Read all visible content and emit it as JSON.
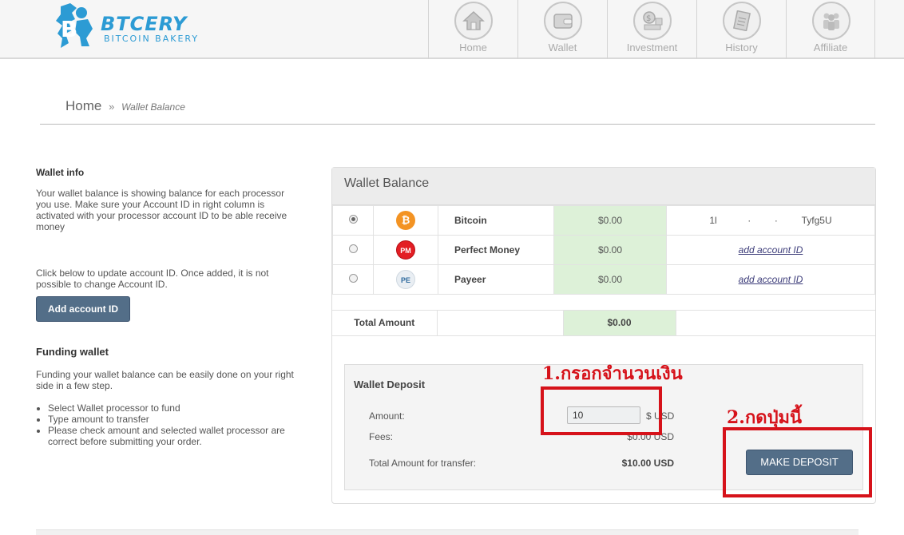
{
  "brand": {
    "title": "BTCERY",
    "subtitle": "BITCOIN BAKERY"
  },
  "nav": [
    {
      "label": "Home",
      "icon": "house-icon"
    },
    {
      "label": "Wallet",
      "icon": "wallet-icon"
    },
    {
      "label": "Investment",
      "icon": "investment-icon"
    },
    {
      "label": "History",
      "icon": "history-icon"
    },
    {
      "label": "Affiliate",
      "icon": "affiliate-icon"
    }
  ],
  "breadcrumb": {
    "home": "Home",
    "separator": "»",
    "current": "Wallet Balance"
  },
  "wallet_info": {
    "title": "Wallet info",
    "text": "Your wallet balance is showing balance for each processor you use. Make sure your Account ID in right column is activated with your processor account ID to be able receive money",
    "update_text": "Click below to update account ID. Once added, it is not possible to change Account ID.",
    "add_button": "Add account ID"
  },
  "funding": {
    "title": "Funding wallet",
    "text": "Funding your wallet balance can be easily done on your right side in a few step.",
    "steps": [
      "Select Wallet processor to fund",
      "Type amount to transfer",
      "Please check amount and selected wallet processor are correct before submitting your order."
    ]
  },
  "balance": {
    "title": "Wallet Balance",
    "rows": [
      {
        "name": "Bitcoin",
        "amount": "$0.00",
        "account": "1l⁠⠀⠀⠀⠀ ·⠀⠀⠀ ·⠀⠀⠀ Tyfg5U",
        "selected": true,
        "icon": "bitcoin-icon",
        "icon_text": "₿"
      },
      {
        "name": "Perfect Money",
        "amount": "$0.00",
        "account": "add account ID",
        "selected": false,
        "icon": "perfect-money-icon",
        "icon_text": "PM"
      },
      {
        "name": "Payeer",
        "amount": "$0.00",
        "account": "add account ID",
        "selected": false,
        "icon": "payeer-icon",
        "icon_text": "PE"
      }
    ],
    "total_label": "Total Amount",
    "total_amount": "$0.00"
  },
  "deposit": {
    "title": "Wallet Deposit",
    "amount_label": "Amount:",
    "amount_value": "10",
    "unit": "$ USD",
    "fees_label": "Fees:",
    "fees_value": "$0.00 USD",
    "total_label": "Total Amount for transfer:",
    "total_value": "$10.00 USD",
    "button": "MAKE DEPOSIT"
  },
  "annotations": {
    "step1": "1.กรอกจำนวนเงิน",
    "step2": "2.กดปุ่มนี้",
    "color": "#d6121a"
  }
}
